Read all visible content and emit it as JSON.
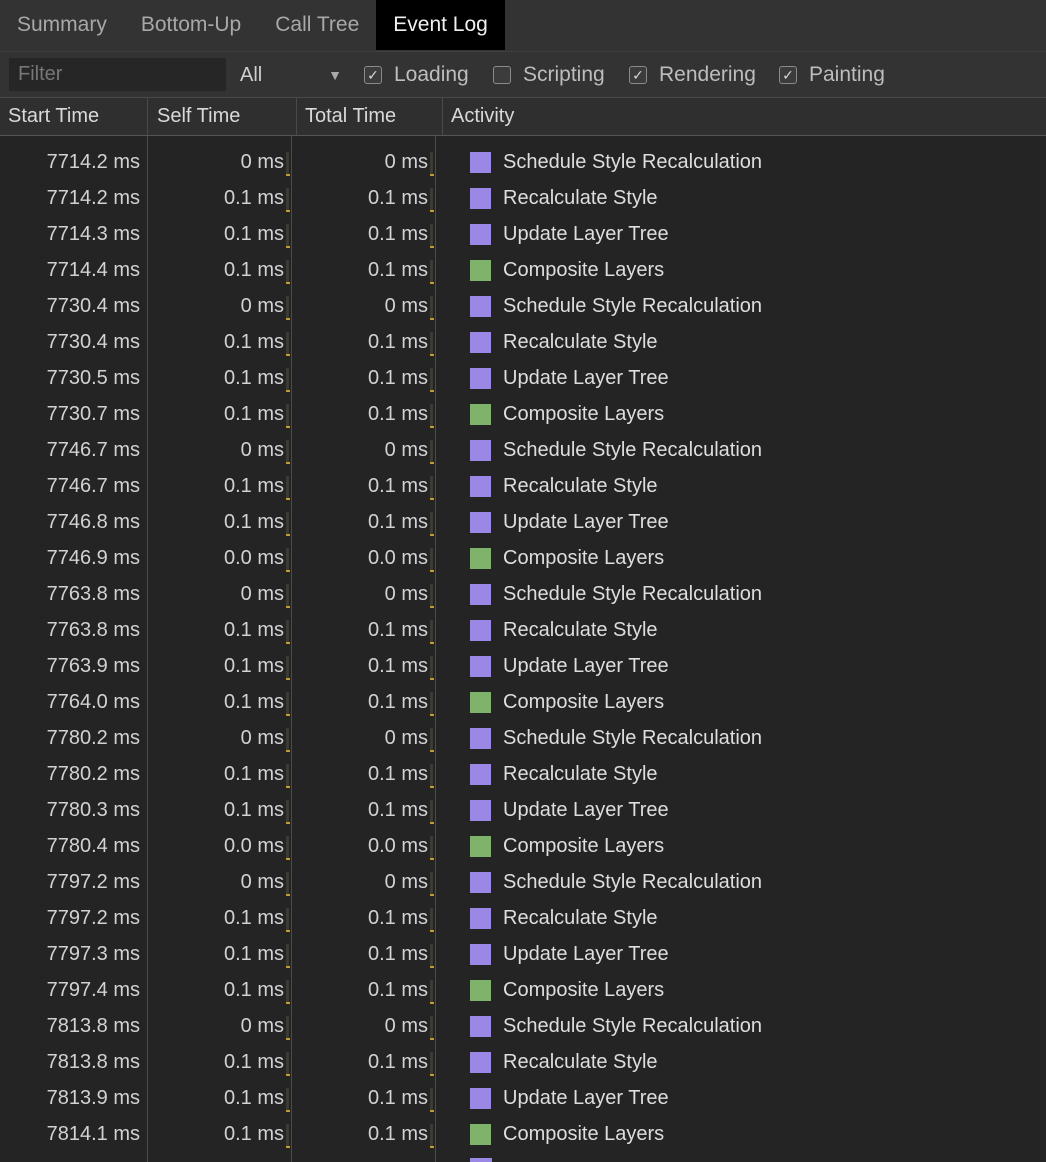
{
  "tabs": [
    {
      "label": "Summary"
    },
    {
      "label": "Bottom-Up"
    },
    {
      "label": "Call Tree"
    },
    {
      "label": "Event Log"
    }
  ],
  "active_tab": "Event Log",
  "filter": {
    "placeholder": "Filter",
    "value": "",
    "select_value": "All",
    "checkboxes": [
      {
        "label": "Loading",
        "checked": true
      },
      {
        "label": "Scripting",
        "checked": false
      },
      {
        "label": "Rendering",
        "checked": true
      },
      {
        "label": "Painting",
        "checked": true
      }
    ]
  },
  "columns": {
    "start_time": "Start Time",
    "self_time": "Self Time",
    "total_time": "Total Time",
    "activity": "Activity"
  },
  "colors": {
    "rendering": "#9b87e5",
    "painting": "#7fb26a",
    "active_tab_bg": "#000000",
    "background": "#242424"
  },
  "rows": [
    {
      "start": "7714.2 ms",
      "self": "0 ms",
      "total": "0 ms",
      "activity": "Schedule Style Recalculation",
      "category": "rendering"
    },
    {
      "start": "7714.2 ms",
      "self": "0.1 ms",
      "total": "0.1 ms",
      "activity": "Recalculate Style",
      "category": "rendering"
    },
    {
      "start": "7714.3 ms",
      "self": "0.1 ms",
      "total": "0.1 ms",
      "activity": "Update Layer Tree",
      "category": "rendering"
    },
    {
      "start": "7714.4 ms",
      "self": "0.1 ms",
      "total": "0.1 ms",
      "activity": "Composite Layers",
      "category": "painting"
    },
    {
      "start": "7730.4 ms",
      "self": "0 ms",
      "total": "0 ms",
      "activity": "Schedule Style Recalculation",
      "category": "rendering"
    },
    {
      "start": "7730.4 ms",
      "self": "0.1 ms",
      "total": "0.1 ms",
      "activity": "Recalculate Style",
      "category": "rendering"
    },
    {
      "start": "7730.5 ms",
      "self": "0.1 ms",
      "total": "0.1 ms",
      "activity": "Update Layer Tree",
      "category": "rendering"
    },
    {
      "start": "7730.7 ms",
      "self": "0.1 ms",
      "total": "0.1 ms",
      "activity": "Composite Layers",
      "category": "painting"
    },
    {
      "start": "7746.7 ms",
      "self": "0 ms",
      "total": "0 ms",
      "activity": "Schedule Style Recalculation",
      "category": "rendering"
    },
    {
      "start": "7746.7 ms",
      "self": "0.1 ms",
      "total": "0.1 ms",
      "activity": "Recalculate Style",
      "category": "rendering"
    },
    {
      "start": "7746.8 ms",
      "self": "0.1 ms",
      "total": "0.1 ms",
      "activity": "Update Layer Tree",
      "category": "rendering"
    },
    {
      "start": "7746.9 ms",
      "self": "0.0 ms",
      "total": "0.0 ms",
      "activity": "Composite Layers",
      "category": "painting"
    },
    {
      "start": "7763.8 ms",
      "self": "0 ms",
      "total": "0 ms",
      "activity": "Schedule Style Recalculation",
      "category": "rendering"
    },
    {
      "start": "7763.8 ms",
      "self": "0.1 ms",
      "total": "0.1 ms",
      "activity": "Recalculate Style",
      "category": "rendering"
    },
    {
      "start": "7763.9 ms",
      "self": "0.1 ms",
      "total": "0.1 ms",
      "activity": "Update Layer Tree",
      "category": "rendering"
    },
    {
      "start": "7764.0 ms",
      "self": "0.1 ms",
      "total": "0.1 ms",
      "activity": "Composite Layers",
      "category": "painting"
    },
    {
      "start": "7780.2 ms",
      "self": "0 ms",
      "total": "0 ms",
      "activity": "Schedule Style Recalculation",
      "category": "rendering"
    },
    {
      "start": "7780.2 ms",
      "self": "0.1 ms",
      "total": "0.1 ms",
      "activity": "Recalculate Style",
      "category": "rendering"
    },
    {
      "start": "7780.3 ms",
      "self": "0.1 ms",
      "total": "0.1 ms",
      "activity": "Update Layer Tree",
      "category": "rendering"
    },
    {
      "start": "7780.4 ms",
      "self": "0.0 ms",
      "total": "0.0 ms",
      "activity": "Composite Layers",
      "category": "painting"
    },
    {
      "start": "7797.2 ms",
      "self": "0 ms",
      "total": "0 ms",
      "activity": "Schedule Style Recalculation",
      "category": "rendering"
    },
    {
      "start": "7797.2 ms",
      "self": "0.1 ms",
      "total": "0.1 ms",
      "activity": "Recalculate Style",
      "category": "rendering"
    },
    {
      "start": "7797.3 ms",
      "self": "0.1 ms",
      "total": "0.1 ms",
      "activity": "Update Layer Tree",
      "category": "rendering"
    },
    {
      "start": "7797.4 ms",
      "self": "0.1 ms",
      "total": "0.1 ms",
      "activity": "Composite Layers",
      "category": "painting"
    },
    {
      "start": "7813.8 ms",
      "self": "0 ms",
      "total": "0 ms",
      "activity": "Schedule Style Recalculation",
      "category": "rendering"
    },
    {
      "start": "7813.8 ms",
      "self": "0.1 ms",
      "total": "0.1 ms",
      "activity": "Recalculate Style",
      "category": "rendering"
    },
    {
      "start": "7813.9 ms",
      "self": "0.1 ms",
      "total": "0.1 ms",
      "activity": "Update Layer Tree",
      "category": "rendering"
    },
    {
      "start": "7814.1 ms",
      "self": "0.1 ms",
      "total": "0.1 ms",
      "activity": "Composite Layers",
      "category": "painting"
    }
  ]
}
